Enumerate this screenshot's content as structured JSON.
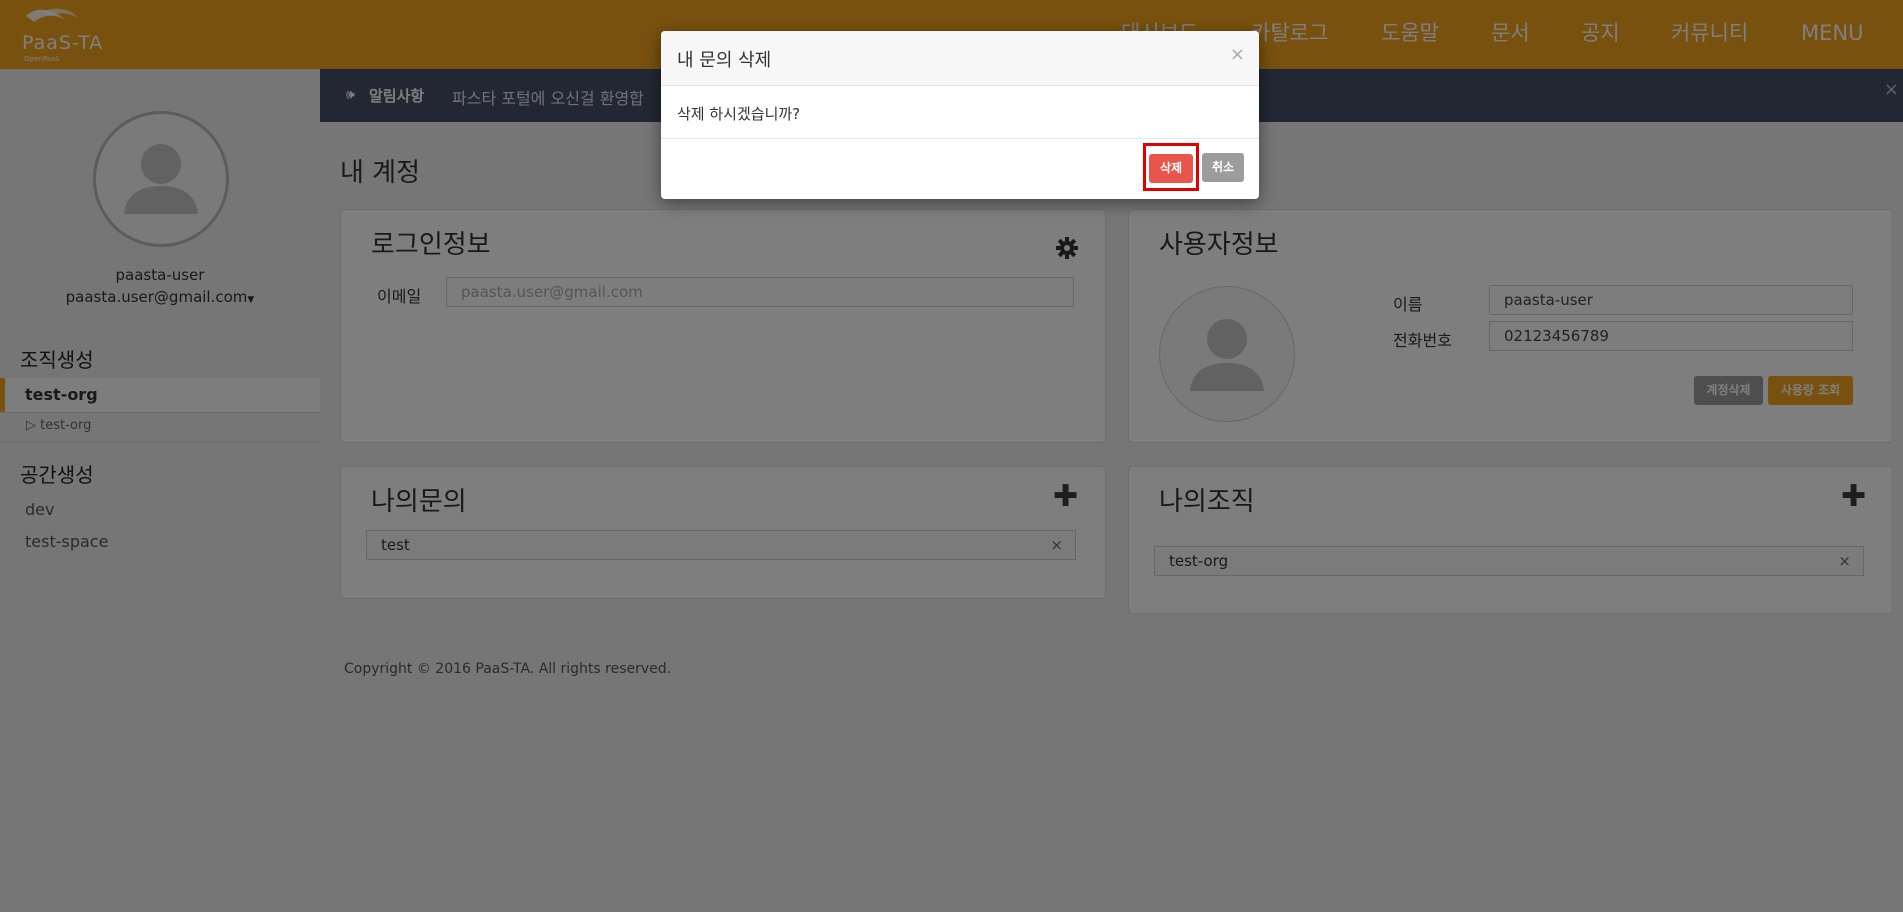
{
  "header": {
    "logo_name": "PaaS-TA",
    "logo_sub": "OpenPaaS",
    "nav": [
      "대시보드",
      "카탈로그",
      "도움말",
      "문서",
      "공지",
      "커뮤니티",
      "MENU"
    ]
  },
  "notice": {
    "label": "알림사항",
    "text": "파스타 포털에 오신걸 환영합",
    "close": "×"
  },
  "sidebar": {
    "username": "paasta-user",
    "email": "paasta.user@gmail.com",
    "org_section": "조직생성",
    "active_org": "test-org",
    "sub_org": "▷ test-org",
    "space_section": "공간생성",
    "spaces": [
      "dev",
      "test-space"
    ]
  },
  "main": {
    "page_title": "내 계정",
    "login_panel": {
      "title": "로그인정보",
      "email_label": "이메일",
      "email_placeholder": "paasta.user@gmail.com"
    },
    "user_panel": {
      "title": "사용자정보",
      "name_label": "이름",
      "name_value": "paasta-user",
      "phone_label": "전화번호",
      "phone_value": "02123456789",
      "delete_account_label": "계정삭제",
      "usage_label": "사용량 조회"
    },
    "inquiry_panel": {
      "title": "나의문의",
      "items": [
        "test"
      ]
    },
    "org_panel": {
      "title": "나의조직",
      "items": [
        "test-org"
      ]
    },
    "copyright": "Copyright © 2016 PaaS-TA. All rights reserved."
  },
  "modal": {
    "title": "내 문의 삭제",
    "close": "×",
    "message": "삭제 하시겠습니까?",
    "delete_label": "삭제",
    "cancel_label": "취소"
  },
  "colors": {
    "brand": "#f0a31d",
    "notice_bg": "#454f66",
    "delete": "#e8564b",
    "highlight": "#e00000"
  }
}
